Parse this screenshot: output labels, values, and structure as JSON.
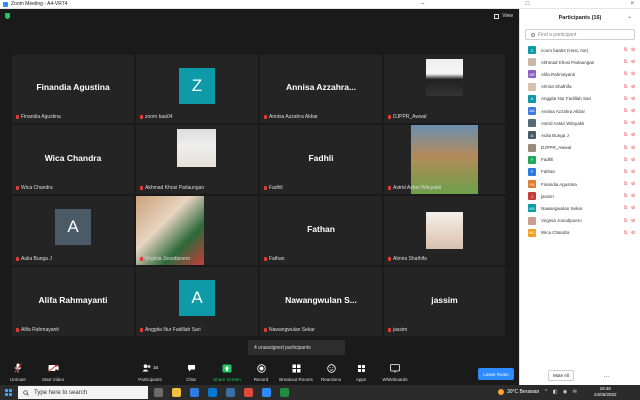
{
  "window": {
    "title": "Zoom Meeting - A4-VR74"
  },
  "top_bar": {
    "view_label": "View"
  },
  "tiles": [
    {
      "name": "Finandia Agustina",
      "label": "Finandia Agustina",
      "kind": "name"
    },
    {
      "name": "Z",
      "label": "zoom baa04",
      "kind": "avatar",
      "color": "#0e9aa7"
    },
    {
      "name": "Annisa  Azzahra...",
      "label": "Annisa Azzahra Akbar",
      "kind": "name"
    },
    {
      "name": "",
      "label": "DJPPR_Awwal",
      "kind": "photo"
    },
    {
      "name": "Wica Chandra",
      "label": "Wica Chandra",
      "kind": "name"
    },
    {
      "name": "",
      "label": "Akhmad Khosi Parlaungan",
      "kind": "photo"
    },
    {
      "name": "Fadhli",
      "label": "Fadhli",
      "kind": "name"
    },
    {
      "name": "",
      "label": "Astrid Astari Wiloyakti",
      "kind": "photo"
    },
    {
      "name": "A",
      "label": "Aulia Bunga J",
      "kind": "avatar",
      "color": "#4a5a66"
    },
    {
      "name": "",
      "label": "Virginia Josodipoero",
      "kind": "photo"
    },
    {
      "name": "Fathan",
      "label": "Fathan",
      "kind": "name"
    },
    {
      "name": "",
      "label": "Almira Shathifa",
      "kind": "photo"
    },
    {
      "name": "Alifa Rahmayanti",
      "label": "Alifa Rahmayanti",
      "kind": "name"
    },
    {
      "name": "A",
      "label": "Anggita Nur Fadillah Sari",
      "kind": "avatar",
      "color": "#0e9aa7"
    },
    {
      "name": "Nawangwulan  S...",
      "label": "Nawangwulan Sekar",
      "kind": "name"
    },
    {
      "name": "jassim",
      "label": "jassim",
      "kind": "name"
    }
  ],
  "unassigned": "4 unassigned participants",
  "toolbar": {
    "unmute": "Unmute",
    "start_video": "Start Video",
    "participants": "Participants",
    "participants_count": "16",
    "chat": "Chat",
    "share_screen": "Share Screen",
    "record": "Record",
    "breakout": "Breakout Rooms",
    "reactions": "Reactions",
    "apps": "Apps",
    "whiteboards": "Whiteboards",
    "leave": "Leave Room"
  },
  "panel": {
    "title": "Participants (16)",
    "search_placeholder": "Find a participant",
    "mute_all": "Mute All",
    "more": "...",
    "participants": [
      {
        "name": "zoom baa04 (Host, me)",
        "initials": "Z",
        "color": "#0e9aa7"
      },
      {
        "name": "Akhmad Khosi Parlaungan",
        "initials": "",
        "color": "#c9b8a8"
      },
      {
        "name": "Alifa Rahmayanti",
        "initials": "AR",
        "color": "#8e5fc7"
      },
      {
        "name": "Almira Shathifa",
        "initials": "",
        "color": "#d9c0b0"
      },
      {
        "name": "Anggita Nur Fadillah Sari",
        "initials": "A",
        "color": "#0e9aa7"
      },
      {
        "name": "Annisa Azzahra Akbar",
        "initials": "AA",
        "color": "#3d7be0"
      },
      {
        "name": "Astrid Astari Wiloyakti",
        "initials": "",
        "color": "#556b7a"
      },
      {
        "name": "Aulia Bunga J",
        "initials": "A",
        "color": "#4a5a66"
      },
      {
        "name": "DJPPR_Awwal",
        "initials": "",
        "color": "#9a8a7a"
      },
      {
        "name": "Fadhli",
        "initials": "F",
        "color": "#22a85a"
      },
      {
        "name": "Fathan",
        "initials": "F",
        "color": "#2d7be0"
      },
      {
        "name": "Finandia Agustina",
        "initials": "FA",
        "color": "#e07a2d"
      },
      {
        "name": "jassim",
        "initials": "J",
        "color": "#c73a3a"
      },
      {
        "name": "Nawangwulan Sekar",
        "initials": "NS",
        "color": "#0e9aa7"
      },
      {
        "name": "Virginia Josodipoero",
        "initials": "",
        "color": "#c9a090"
      },
      {
        "name": "Wica Chandra",
        "initials": "WC",
        "color": "#f0a020"
      }
    ]
  },
  "taskbar": {
    "search_placeholder": "Type here to search",
    "weather": "30°C  Berawan",
    "time": "18:46",
    "date": "24/05/2022"
  }
}
